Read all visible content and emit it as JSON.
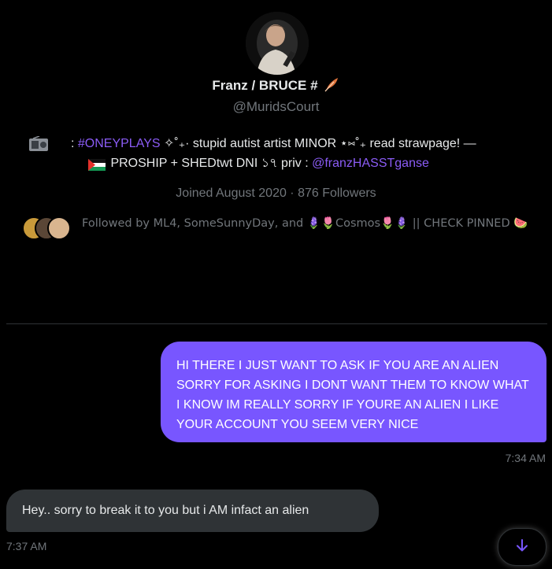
{
  "profile": {
    "display_name": "Franz / BRUCE #",
    "handle": "@MuridsCourt",
    "bio": {
      "line1_prefix": ": ",
      "hashtag": "#ONEYPLAYS",
      "line1_text": " ✧˚₊· stupid autist artist MINOR ⋆⑅˚₊ read strawpage! —",
      "line2_text": " PROSHIP + SHEDtwt DNI ১৭ priv : ",
      "priv_link": "@franzHASSTganse"
    },
    "joined": "Joined August 2020 · 876 Followers",
    "followed_by": "Followed by ML4, SomeSunnyDay, and 🪻🌷Cosmos🌷🪻 || CHECK PINNED 🍉"
  },
  "messages": [
    {
      "text": "HI THERE I JUST WANT TO ASK IF YOU ARE AN ALIEN SORRY FOR ASKING I DONT WANT THEM TO KNOW WHAT I KNOW IM REALLY SORRY IF YOURE AN ALIEN I LIKE YOUR ACCOUNT YOU SEEM VERY NICE",
      "time": "7:34 AM"
    },
    {
      "text": "Hey.. sorry to break it to you but i AM infact an alien",
      "time": "7:37 AM"
    }
  ],
  "icons": {
    "feather": "feather-icon",
    "radio": "radio-emoji-icon",
    "flag": "palestine-flag-icon",
    "scroll_down": "arrow-down-icon"
  },
  "colors": {
    "accent": "#7856ff",
    "link": "#8b5cf6",
    "received_bubble": "#2f3336",
    "muted": "#71767b"
  }
}
